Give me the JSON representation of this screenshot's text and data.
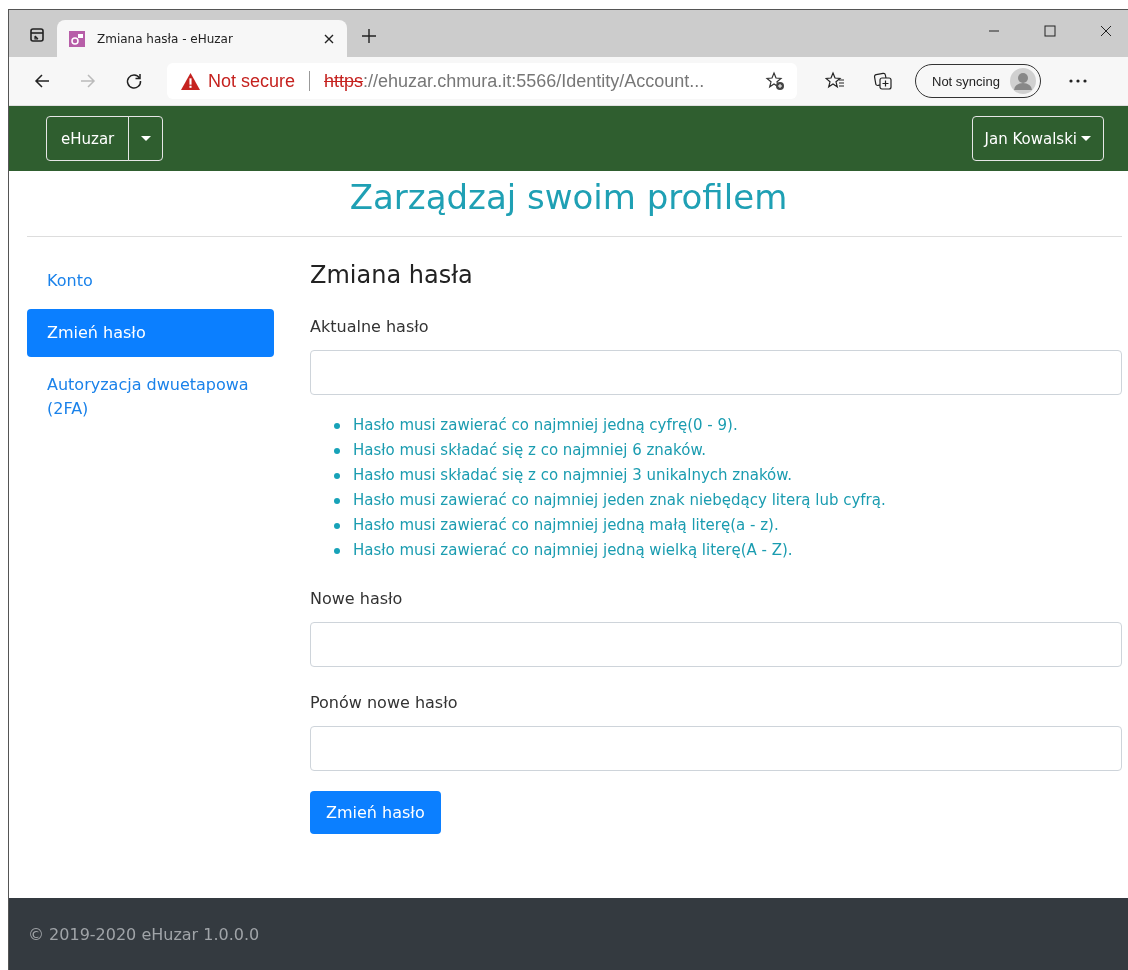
{
  "browser": {
    "tab_title": "Zmiana hasła - eHuzar",
    "security": "Not secure",
    "url_scheme": "https",
    "url_rest": "://ehuzar.chmura.it:5566/Identity/Account...",
    "sync": "Not syncing"
  },
  "navbar": {
    "brand": "eHuzar",
    "user": "Jan Kowalski"
  },
  "heading": "Zarządzaj swoim profilem",
  "sidebar": {
    "items": [
      {
        "label": "Konto",
        "selected": false
      },
      {
        "label": "Zmień hasło",
        "selected": true
      },
      {
        "label": "Autoryzacja dwuetapowa (2FA)",
        "selected": false
      }
    ]
  },
  "form": {
    "title": "Zmiana hasła",
    "fields": [
      {
        "label": "Aktualne hasło"
      },
      {
        "label": "Nowe hasło"
      },
      {
        "label": "Ponów nowe hasło"
      }
    ],
    "rules": [
      "Hasło musi zawierać co najmniej jedną cyfrę(0 - 9).",
      "Hasło musi składać się z co najmniej 6 znaków.",
      "Hasło musi składać się z co najmniej 3 unikalnych znaków.",
      "Hasło musi zawierać co najmniej jeden znak niebędący literą lub cyfrą.",
      "Hasło musi zawierać co najmniej jedną małą literę(a - z).",
      "Hasło musi zawierać co najmniej jedną wielką literę(A - Z)."
    ],
    "submit": "Zmień hasło"
  },
  "footer": "© 2019-2020 eHuzar 1.0.0.0"
}
